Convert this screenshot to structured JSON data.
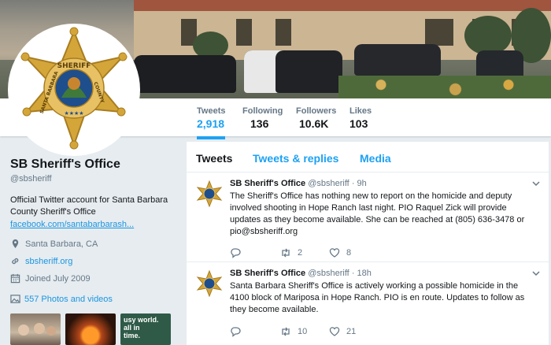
{
  "profile": {
    "name": "SB Sheriff's Office",
    "handle": "@sbsheriff",
    "bio": "Official Twitter account for Santa Barbara County Sheriff's Office",
    "link_text": "facebook.com/santabarbarash...",
    "location": "Santa Barbara, CA",
    "website": "sbsheriff.org",
    "joined": "Joined July 2009",
    "photos": "557 Photos and videos",
    "badge_text": {
      "top": "SHERIFF",
      "left": "SANTA BARBARA",
      "right": "COUNTY"
    }
  },
  "stats": [
    {
      "label": "Tweets",
      "value": "2,918"
    },
    {
      "label": "Following",
      "value": "136"
    },
    {
      "label": "Followers",
      "value": "10.6K"
    },
    {
      "label": "Likes",
      "value": "103"
    }
  ],
  "tabs": [
    "Tweets",
    "Tweets & replies",
    "Media"
  ],
  "tweets": [
    {
      "name": "SB Sheriff's Office",
      "handle": "@sbsheriff",
      "time": "· 9h",
      "text": "The Sheriff's Office has nothing new to report on the homicide and deputy involved shooting in Hope Ranch last night. PIO Raquel Zick will provide updates as they become available.  She can be reached at (805) 636-3478 or pio@sbsheriff.org",
      "replies": "",
      "retweets": "2",
      "likes": "8"
    },
    {
      "name": "SB Sheriff's Office",
      "handle": "@sbsheriff",
      "time": "· 18h",
      "text": "Santa Barbara Sheriff's Office is actively working a possible homicide in the 4100 block of Mariposa in Hope Ranch.  PIO is en route.  Updates to follow as they become available.",
      "replies": "",
      "retweets": "10",
      "likes": "21"
    }
  ],
  "thumb_texts": [
    "usy world.",
    "all in",
    "time."
  ],
  "colors": {
    "accent": "#1da1f2",
    "badge_gold": "#d4a63a",
    "badge_blue": "#1f4e8c"
  },
  "icons": [
    "location-icon",
    "link-icon",
    "calendar-icon",
    "photos-icon",
    "reply-icon",
    "retweet-icon",
    "like-icon",
    "chevron-down-icon"
  ]
}
